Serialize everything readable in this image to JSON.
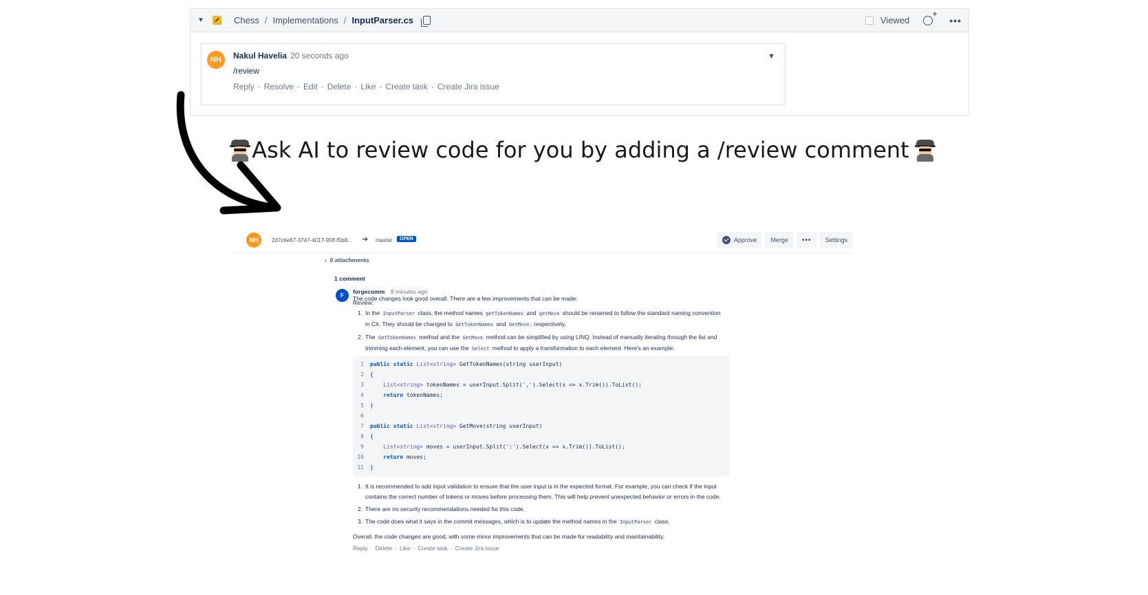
{
  "file_header": {
    "breadcrumb": [
      "Chess",
      "Implementations"
    ],
    "file_name": "InputParser.cs",
    "viewed_label": "Viewed"
  },
  "top_comment": {
    "avatar_initials": "NH",
    "author": "Nakul Havelia",
    "time": "20 seconds ago",
    "text": "/review",
    "actions": [
      "Reply",
      "Resolve",
      "Edit",
      "Delete",
      "Like",
      "Create task",
      "Create Jira issue"
    ]
  },
  "headline": "Ask AI to review code for you by adding a /review comment",
  "pr": {
    "avatar_initials": "NH",
    "source_branch": "2d7c6e67-3747-4017-95ff-f5b8...",
    "target_branch": "master",
    "status": "OPEN",
    "buttons": {
      "approve": "Approve",
      "merge": "Merge",
      "more": "•••",
      "settings": "Settings"
    },
    "attachments": "0 attachments",
    "comment_count": "1 comment"
  },
  "bot_comment": {
    "avatar_initials": "F",
    "author": "forgecomm",
    "time": "8 minutes ago",
    "review_label": "Review:",
    "intro": "The code changes look good overall. There are a few improvements that can be made:",
    "item1": {
      "num": "1.",
      "t1": "In the ",
      "c1": "InputParser",
      "t2": " class, the method names ",
      "c2": "getTokenNames",
      "t3": " and ",
      "c3": "getMove",
      "t4": " should be renamed to follow the standard naming convention",
      "t5": "in C#. They should be changed to ",
      "c4": "GetTokenNames",
      "t6": " and ",
      "c5": "GetMove",
      "t7": ", respectively."
    },
    "item2": {
      "num": "2.",
      "t1": "The ",
      "c1": "GetTokenNames",
      "t2": " method and the ",
      "c2": "GetMove",
      "t3": " method can be simplified by using LINQ. Instead of manually iterating through the list and",
      "t4": "trimming each element, you can use the ",
      "c3": "Select",
      "t5": " method to apply a transformation to each element. Here's an example:"
    },
    "code": [
      {
        "n": "1",
        "kw": "public static ",
        "ty": "List<string>",
        "rest": " GetTokenNames(string userInput)"
      },
      {
        "n": "2",
        "kw": "",
        "ty": "",
        "rest": "{"
      },
      {
        "n": "3",
        "kw": "    ",
        "ty": "List<string>",
        "rest": " tokenNames = userInput.Split(',').Select(x => x.Trim()).ToList();"
      },
      {
        "n": "4",
        "kw": "    return",
        "ty": "",
        "rest": " tokenNames;"
      },
      {
        "n": "5",
        "kw": "",
        "ty": "",
        "rest": "}"
      },
      {
        "n": "6",
        "kw": "",
        "ty": "",
        "rest": ""
      },
      {
        "n": "7",
        "kw": "public static ",
        "ty": "List<string>",
        "rest": " GetMove(string userInput)"
      },
      {
        "n": "8",
        "kw": "",
        "ty": "",
        "rest": "{"
      },
      {
        "n": "9",
        "kw": "    ",
        "ty": "List<string>",
        "rest": " moves = userInput.Split(':').Select(x => x.Trim()).ToList();"
      },
      {
        "n": "10",
        "kw": "    return",
        "ty": "",
        "rest": " moves;"
      },
      {
        "n": "11",
        "kw": "",
        "ty": "",
        "rest": "}"
      }
    ],
    "post1": {
      "num": "1.",
      "line1": "It is recommended to add input validation to ensure that the user input is in the expected format. For example, you can check if the input",
      "line2": "contains the correct number of tokens or moves before processing them. This will help prevent unexpected behavior or errors in the code."
    },
    "post2": {
      "num": "2.",
      "line1": "There are no security recommendations needed for this code."
    },
    "post3": {
      "num": "3.",
      "t1": "The code does what it says in the commit messages, which is to update the method names in the ",
      "c1": "InputParser",
      "t2": " class."
    },
    "outro": "Overall, the code changes are good, with some minor improvements that can be made for readability and maintainability.",
    "actions": [
      "Reply",
      "Delete",
      "Like",
      "Create task",
      "Create Jira issue"
    ]
  }
}
